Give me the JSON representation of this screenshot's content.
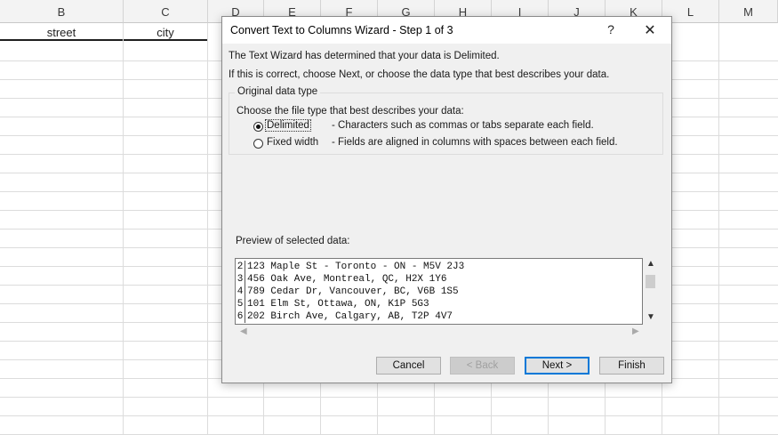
{
  "sheet": {
    "columns": [
      "B",
      "C",
      "D",
      "E",
      "F",
      "G",
      "H",
      "I",
      "J",
      "K",
      "L",
      "M"
    ],
    "cells": {
      "b1": "street",
      "c1": "city"
    }
  },
  "dialog": {
    "title": "Convert Text to Columns Wizard - Step 1 of 3",
    "help_icon": "?",
    "close_icon": "✕",
    "intro_line1": "The Text Wizard has determined that your data is Delimited.",
    "intro_line2": "If this is correct, choose Next, or choose the data type that best describes your data.",
    "group_title": "Original data type",
    "group_prompt": "Choose the file type that best describes your data:",
    "options": [
      {
        "label": "Delimited",
        "desc": "- Characters such as commas or tabs separate each field.",
        "checked": true
      },
      {
        "label": "Fixed width",
        "desc": "- Fields are aligned in columns with spaces between each field.",
        "checked": false
      }
    ],
    "preview_label": "Preview of selected data:",
    "preview_rows": [
      {
        "num": "2",
        "text": "123 Maple St - Toronto - ON - M5V 2J3"
      },
      {
        "num": "3",
        "text": "456 Oak Ave, Montreal, QC, H2X 1Y6"
      },
      {
        "num": "4",
        "text": "789 Cedar Dr, Vancouver, BC, V6B 1S5"
      },
      {
        "num": "5",
        "text": "101 Elm St, Ottawa, ON, K1P 5G3"
      },
      {
        "num": "6",
        "text": "202 Birch Ave, Calgary, AB, T2P 4V7"
      }
    ],
    "buttons": {
      "cancel": "Cancel",
      "back": "< Back",
      "next": "Next >",
      "finish": "Finish"
    }
  }
}
